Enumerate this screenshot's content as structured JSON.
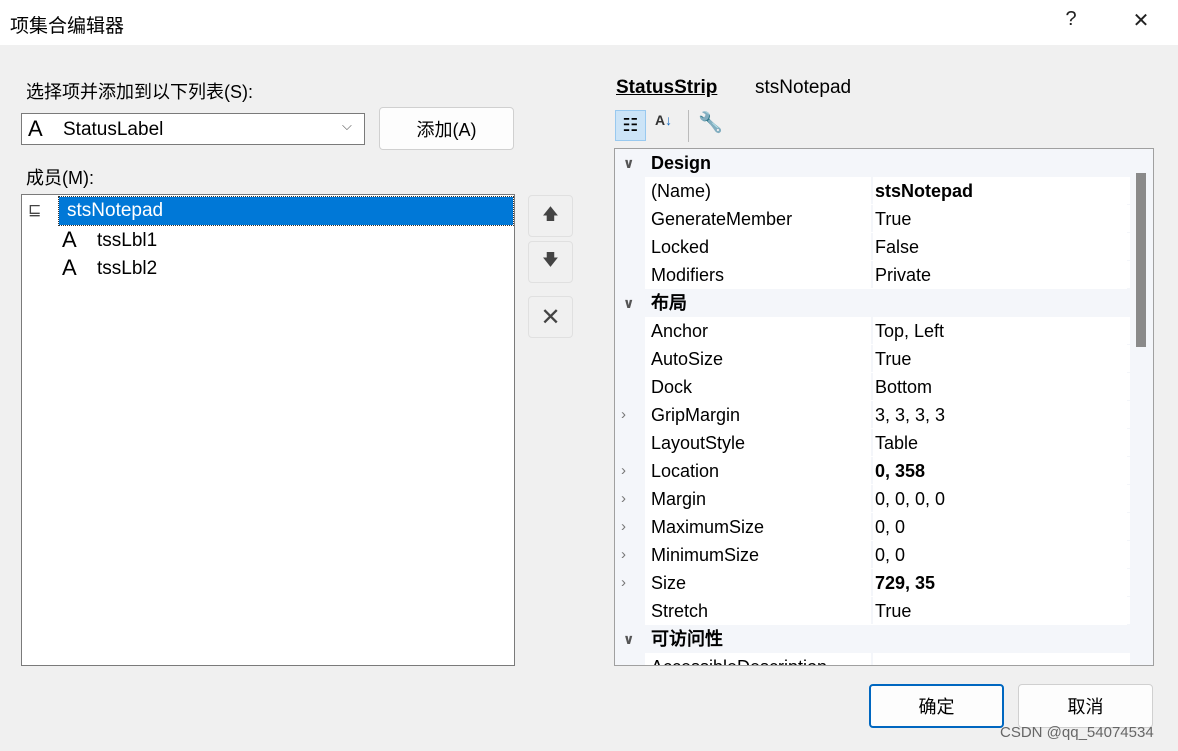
{
  "window": {
    "title": "项集合编辑器",
    "help": "?",
    "close": "✕"
  },
  "left": {
    "select_label": "选择项并添加到以下列表(S):",
    "combo_value": "StatusLabel",
    "add_button": "添加(A)",
    "members_label": "成员(M):",
    "members": [
      {
        "name": "stsNotepad",
        "icon": "statusstrip-icon",
        "selected": true
      },
      {
        "name": "tssLbl1",
        "icon": "label-a-icon"
      },
      {
        "name": "tssLbl2",
        "icon": "label-a-icon"
      }
    ]
  },
  "right": {
    "type": "StatusStrip",
    "object": "stsNotepad",
    "rows": [
      {
        "cat": "Design"
      },
      {
        "name": "(Name)",
        "value": "stsNotepad",
        "bold": true
      },
      {
        "name": "GenerateMember",
        "value": "True"
      },
      {
        "name": "Locked",
        "value": "False"
      },
      {
        "name": "Modifiers",
        "value": "Private"
      },
      {
        "cat": "布局"
      },
      {
        "name": "Anchor",
        "value": "Top, Left"
      },
      {
        "name": "AutoSize",
        "value": "True"
      },
      {
        "name": "Dock",
        "value": "Bottom"
      },
      {
        "name": "GripMargin",
        "value": "3, 3, 3, 3",
        "expand": true
      },
      {
        "name": "LayoutStyle",
        "value": "Table"
      },
      {
        "name": "Location",
        "value": "0, 358",
        "bold": true,
        "expand": true
      },
      {
        "name": "Margin",
        "value": "0, 0, 0, 0",
        "expand": true
      },
      {
        "name": "MaximumSize",
        "value": "0, 0",
        "expand": true
      },
      {
        "name": "MinimumSize",
        "value": "0, 0",
        "expand": true
      },
      {
        "name": "Size",
        "value": "729, 35",
        "bold": true,
        "expand": true
      },
      {
        "name": "Stretch",
        "value": "True"
      },
      {
        "cat": "可访问性"
      },
      {
        "name": "AccessibleDescription",
        "value": ""
      }
    ]
  },
  "footer": {
    "ok": "确定",
    "cancel": "取消",
    "watermark": "CSDN @qq_54074534"
  },
  "colors": {
    "selection": "#0078d7",
    "accent_border": "#0067c0"
  }
}
